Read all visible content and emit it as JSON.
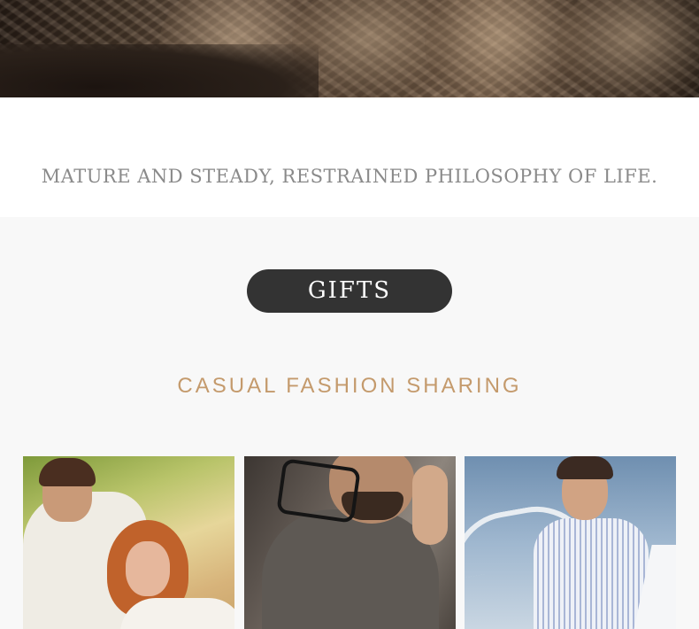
{
  "philosophy": {
    "text": "MATURE AND STEADY, RESTRAINED PHILOSOPHY OF LIFE."
  },
  "gifts": {
    "label": "GIFTS"
  },
  "section": {
    "title": "CASUAL FASHION SHARING"
  },
  "colors": {
    "pill_bg": "#333333",
    "title_accent": "#c49a6c",
    "philosophy_text": "#8a8a8a",
    "section_bg": "#f8f8f8"
  }
}
